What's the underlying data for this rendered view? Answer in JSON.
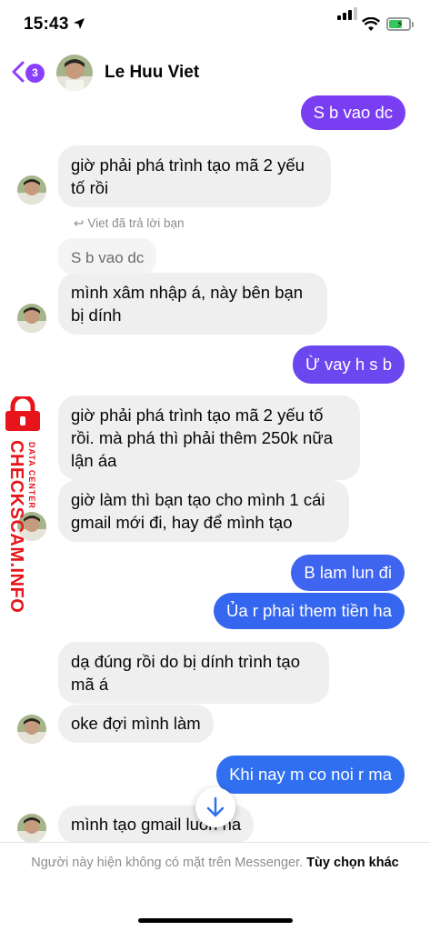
{
  "status_bar": {
    "time": "15:43",
    "battery_color": "#34c759"
  },
  "header": {
    "back_badge": "3",
    "contact_name": "Le Huu Viet"
  },
  "colors": {
    "outgoing_top": "#7a3ef2",
    "outgoing_bottom": "#2f6ff0",
    "incoming": "#efefef",
    "accent": "#8a3ffc"
  },
  "messages": [
    {
      "side": "out",
      "text": "S b vao dc"
    },
    {
      "side": "in",
      "text": "giờ phải phá trình tạo mã 2 yếu\ntố rồi"
    },
    {
      "side": "note",
      "text": "Viet đã trả lời bạn"
    },
    {
      "side": "quoted",
      "text": "S b vao dc"
    },
    {
      "side": "in",
      "text": "mình xâm nhập á, này bên bạn\nbị dính"
    },
    {
      "side": "out",
      "text": "Ừ vay h s b"
    },
    {
      "side": "in",
      "text": "giờ phải phá trình tạo mã 2 yếu tố\nrồi. mà phá thì phải thêm 250k nữa\nlận áa"
    },
    {
      "side": "in",
      "text": "giờ làm thì bạn tạo cho mình 1 cái\ngmail mới đi, hay để mình tạo"
    },
    {
      "side": "out",
      "text": "B lam lun đi"
    },
    {
      "side": "out",
      "text": "Ủa r phai them tiền ha"
    },
    {
      "side": "in",
      "text": "dạ đúng rồi do bị dính trình tạo\nmã á"
    },
    {
      "side": "in",
      "text": "oke đợi mình làm"
    },
    {
      "side": "out",
      "text": "Khi nay m co noi r ma"
    },
    {
      "side": "in",
      "text": "mình tạo gmail luôn na"
    }
  ],
  "watermark": {
    "main": "CHECKSCAM.INFO",
    "sub": "DATA CENTER"
  },
  "footer": {
    "text": "Người này hiện không có mặt trên Messenger.",
    "options": "Tùy chọn khác"
  },
  "icons": {
    "back": "chevron-left-icon",
    "scroll": "arrow-down-icon",
    "reply": "reply-arrow-icon"
  }
}
